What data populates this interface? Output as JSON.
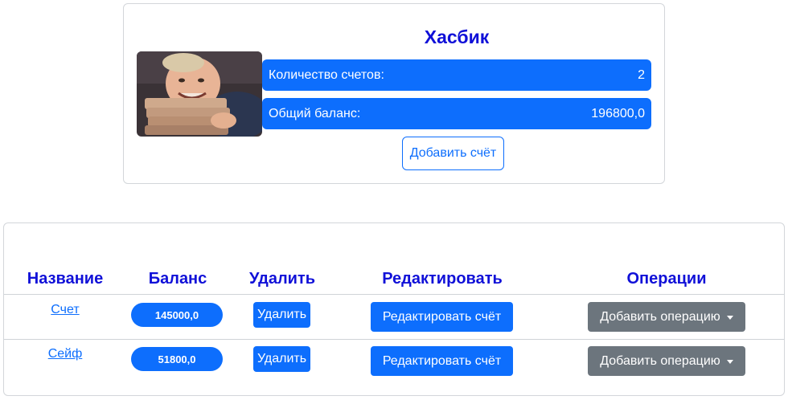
{
  "profile": {
    "name": "Хасбик",
    "accounts_count_label": "Количество счетов:",
    "accounts_count_value": "2",
    "total_balance_label": "Общий баланс:",
    "total_balance_value": "196800,0",
    "add_account_label": "Добавить счёт"
  },
  "table": {
    "headers": [
      "Название",
      "Баланс",
      "Удалить",
      "Редактировать",
      "Операции"
    ],
    "rows": [
      {
        "name": "Счет",
        "balance": "145000,0",
        "delete_label": "Удалить",
        "edit_label": "Редактировать счёт",
        "ops_label": "Добавить операцию"
      },
      {
        "name": "Сейф",
        "balance": "51800,0",
        "delete_label": "Удалить",
        "edit_label": "Редактировать счёт",
        "ops_label": "Добавить операцию"
      }
    ]
  },
  "colors": {
    "primary": "#0d6efd",
    "heading": "#1010d8",
    "secondary": "#6c757d"
  }
}
